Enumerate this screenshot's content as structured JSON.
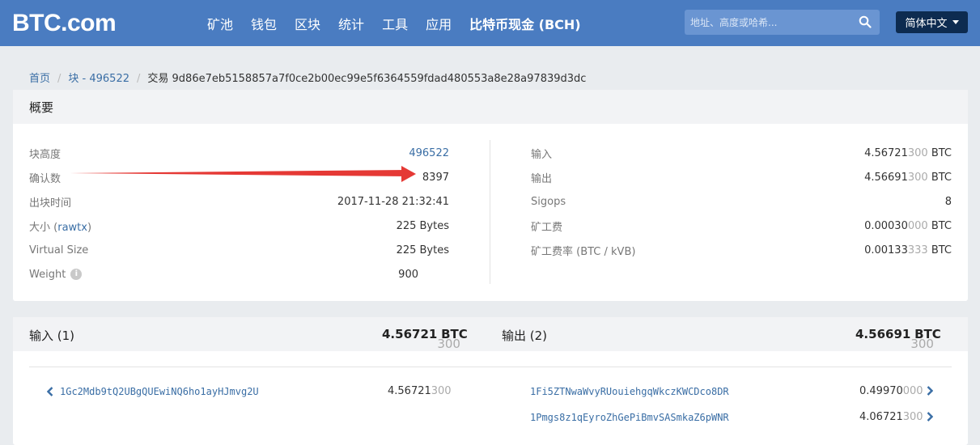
{
  "header": {
    "logo": "BTC.com",
    "nav": [
      "矿池",
      "钱包",
      "区块",
      "统计",
      "工具",
      "应用"
    ],
    "nav_highlight": "比特币现金 (BCH)",
    "search_placeholder": "地址、高度或哈希...",
    "lang": "简体中文",
    "color": "#4a7cc1"
  },
  "breadcrumb": {
    "home": "首页",
    "block": "块 - 496522",
    "current": "交易 9d86e7eb5158857a7f0ce2b00ec99e5f6364559fdad480553a8e28a97839d3dc"
  },
  "summary": {
    "title": "概要",
    "left": [
      {
        "k": "块高度",
        "v": "496522"
      },
      {
        "k": "确认数",
        "v": "8397"
      },
      {
        "k": "出块时间",
        "v": "2017-11-28 21:32:41"
      },
      {
        "k": "大小",
        "k_link": "rawtx",
        "v": "225 Bytes"
      },
      {
        "k": "Virtual Size",
        "v": "225 Bytes"
      },
      {
        "k": "Weight",
        "v": "900"
      }
    ],
    "right": [
      {
        "k": "输入",
        "v_main": "4.56721",
        "v_dim": "300",
        "unit": "BTC"
      },
      {
        "k": "输出",
        "v_main": "4.56691",
        "v_dim": "300",
        "unit": "BTC"
      },
      {
        "k": "Sigops",
        "v": "8"
      },
      {
        "k": "矿工费",
        "v_main": "0.00030",
        "v_dim": "000",
        "unit": "BTC"
      },
      {
        "k": "矿工费率 (BTC / kVB)",
        "v_main": "0.00133",
        "v_dim": "333",
        "unit": "BTC"
      }
    ]
  },
  "io": {
    "inputs_label": "输入 (1)",
    "inputs_total_main": "4.56721",
    "inputs_total_dim": "300",
    "outputs_label": "输出 (2)",
    "outputs_total_main": "4.56691",
    "outputs_total_dim": "300",
    "unit": "BTC",
    "inputs": [
      {
        "address": "1Gc2Mdb9tQ2UBgQUEwiNQ6ho1ayHJmvg2U",
        "amount_main": "4.56721",
        "amount_dim": "300"
      }
    ],
    "outputs": [
      {
        "address": "1Fi5ZTNwaWvyRUouiehgqWkczKWCDco8DR",
        "amount_main": "0.49970",
        "amount_dim": "000"
      },
      {
        "address": "1Pmgs8z1qEyroZhGePiBmvSASmkaZ6pWNR",
        "amount_main": "4.06721",
        "amount_dim": "300"
      }
    ]
  },
  "annotation_color": "#e53935"
}
